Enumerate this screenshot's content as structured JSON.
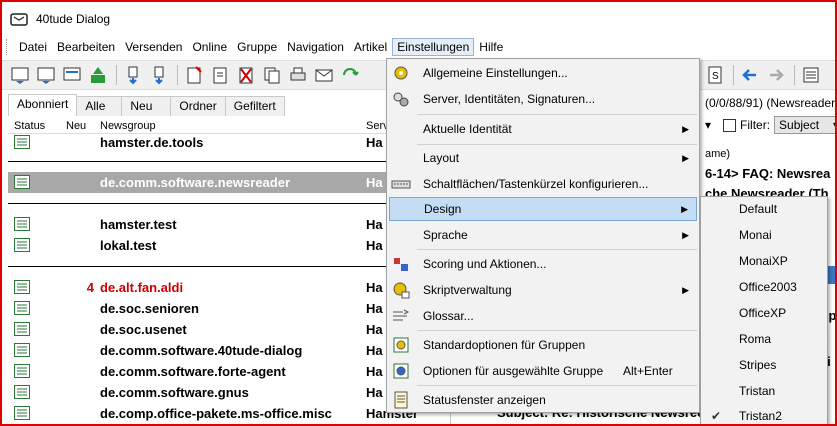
{
  "window": {
    "title": "40tude Dialog"
  },
  "menubar": {
    "items": [
      "Datei",
      "Bearbeiten",
      "Versenden",
      "Online",
      "Gruppe",
      "Navigation",
      "Artikel",
      "Einstellungen",
      "Hilfe"
    ]
  },
  "tabs": [
    "Abonniert",
    "Alle",
    "Neu",
    "Ordner",
    "Gefiltert"
  ],
  "grid": {
    "headers": {
      "status": "Status",
      "new": "Neu",
      "newsgroup": "Newsgroup",
      "server": "Serv"
    },
    "rows": [
      {
        "count": "",
        "name": "hamster.de.tools",
        "server": "Ha"
      },
      {
        "count": "",
        "name": "de.comm.software.newsreader",
        "server": "Ha"
      },
      {
        "count": "",
        "name": "hamster.test",
        "server": "Ha"
      },
      {
        "count": "",
        "name": "lokal.test",
        "server": "Ha"
      },
      {
        "count": "4",
        "name": "de.alt.fan.aldi",
        "server": "Ha"
      },
      {
        "count": "",
        "name": "de.soc.senioren",
        "server": "Ha"
      },
      {
        "count": "",
        "name": "de.soc.usenet",
        "server": "Ha"
      },
      {
        "count": "",
        "name": "de.comm.software.40tude-dialog",
        "server": "Ha"
      },
      {
        "count": "",
        "name": "de.comm.software.forte-agent",
        "server": "Ha"
      },
      {
        "count": "",
        "name": "de.comm.software.gnus",
        "server": "Ha"
      },
      {
        "count": "",
        "name": "de.comp.office-pakete.ms-office.misc",
        "server": "Hamster"
      }
    ]
  },
  "right_pane": {
    "path": "(0/0/88/91) (Newsreader",
    "filter_label": "Filter:",
    "filter_value": "Subject",
    "line_ame": "ame)",
    "line_faq": "6-14> FAQ: Newsrea",
    "line_the": "che Newsreader (Th",
    "line_mp": "mp",
    "line_ts": "ts",
    "line_wi": "wi",
    "line_subject": "Subject: Re: Historische Newsree"
  },
  "einstellungen_menu": {
    "items": [
      {
        "label": "Allgemeine Einstellungen...",
        "icon": "gears-icon"
      },
      {
        "label": "Server, Identitäten, Signaturen...",
        "icon": "server-identity-icon"
      },
      {
        "label": "Aktuelle Identität",
        "submenu": true
      },
      {
        "label": "Layout",
        "submenu": true
      },
      {
        "label": "Schaltflächen/Tastenkürzel konfigurieren...",
        "icon": "keyboard-icon"
      },
      {
        "label": "Design",
        "submenu": true
      },
      {
        "label": "Sprache",
        "submenu": true
      },
      {
        "label": "Scoring und Aktionen...",
        "icon": "scoring-icon"
      },
      {
        "label": "Skriptverwaltung",
        "icon": "script-icon",
        "submenu": true
      },
      {
        "label": "Glossar...",
        "icon": "glossary-icon"
      },
      {
        "label": "Standardoptionen für Gruppen",
        "icon": "group-options-icon"
      },
      {
        "label": "Optionen für ausgewählte Gruppe",
        "icon": "selected-group-options-icon",
        "shortcut": "Alt+Enter"
      },
      {
        "label": "Statusfenster anzeigen",
        "icon": "status-window-icon"
      }
    ]
  },
  "design_submenu": {
    "items": [
      "Default",
      "Monai",
      "MonaiXP",
      "Office2003",
      "OfficeXP",
      "Roma",
      "Stripes",
      "Tristan",
      "Tristan2"
    ],
    "checked": "Tristan2"
  },
  "colors": {
    "accent_red": "#d00000",
    "highlight": "#c5dcf5",
    "window_border": "#e00000"
  }
}
